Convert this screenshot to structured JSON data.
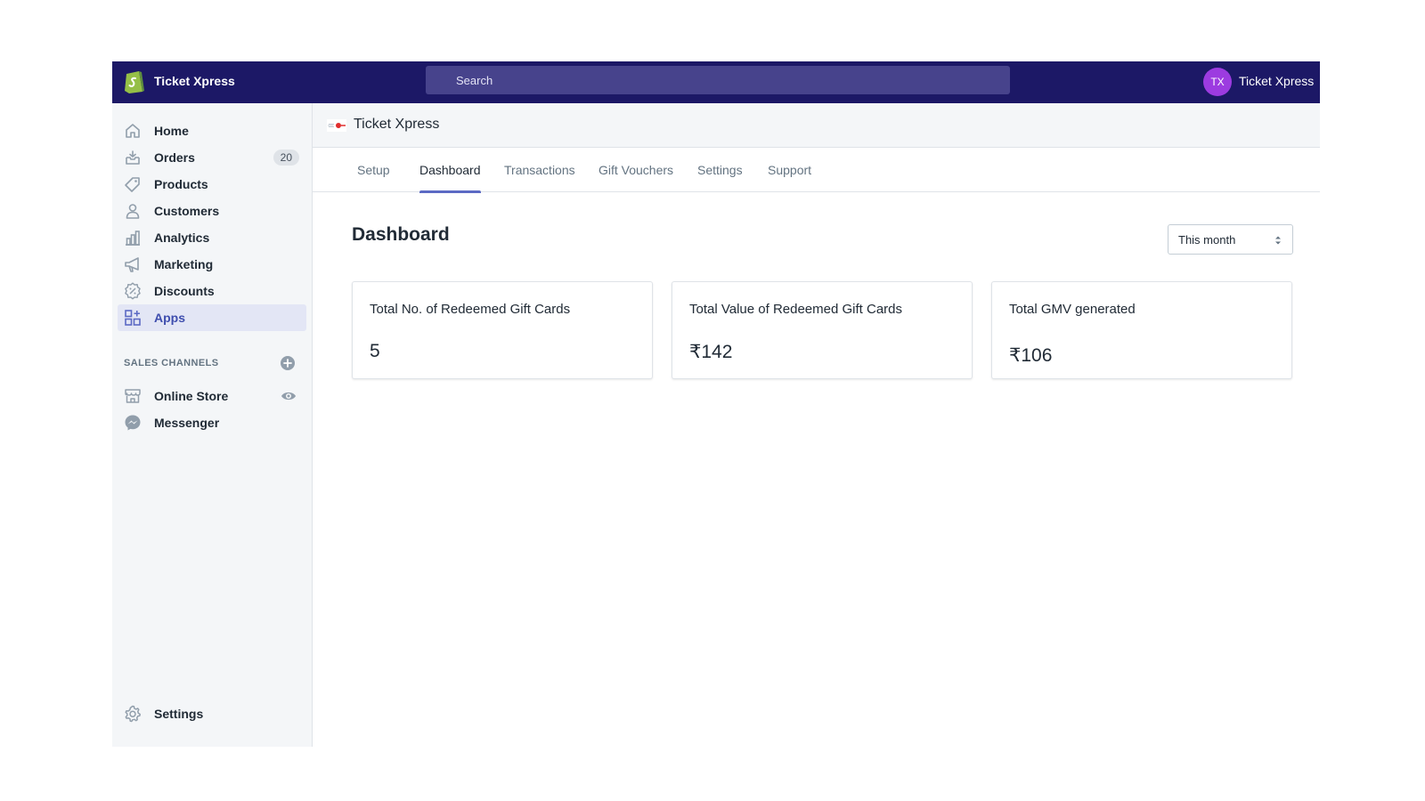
{
  "topbar": {
    "store_name": "Ticket Xpress",
    "search_placeholder": "Search",
    "user_initials": "TX",
    "user_name": "Ticket Xpress"
  },
  "sidebar": {
    "items": [
      {
        "label": "Home",
        "icon": "home-icon"
      },
      {
        "label": "Orders",
        "icon": "orders-icon",
        "badge": "20"
      },
      {
        "label": "Products",
        "icon": "tag-icon"
      },
      {
        "label": "Customers",
        "icon": "person-icon"
      },
      {
        "label": "Analytics",
        "icon": "bar-chart-icon"
      },
      {
        "label": "Marketing",
        "icon": "megaphone-icon"
      },
      {
        "label": "Discounts",
        "icon": "discount-icon"
      },
      {
        "label": "Apps",
        "icon": "apps-icon",
        "active": true
      }
    ],
    "sales_channels_title": "SALES CHANNELS",
    "channels": [
      {
        "label": "Online Store",
        "icon": "store-icon"
      },
      {
        "label": "Messenger",
        "icon": "messenger-icon"
      }
    ],
    "settings_label": "Settings"
  },
  "app": {
    "title": "Ticket Xpress",
    "tabs": [
      "Setup",
      "Dashboard",
      "Transactions",
      "Gift Vouchers",
      "Settings",
      "Support"
    ],
    "active_tab": "Dashboard"
  },
  "dashboard": {
    "title": "Dashboard",
    "period": "This month",
    "cards": [
      {
        "title": "Total No. of Redeemed Gift Cards",
        "value": "5"
      },
      {
        "title": "Total Value of Redeemed Gift Cards",
        "value": "₹142"
      },
      {
        "title": "Total GMV generated",
        "value": "₹106"
      }
    ]
  },
  "colors": {
    "topbar_bg": "#1c1866",
    "accent": "#5c6ac4",
    "avatar": "#9c3be0",
    "logo_green": "#95bf47"
  }
}
